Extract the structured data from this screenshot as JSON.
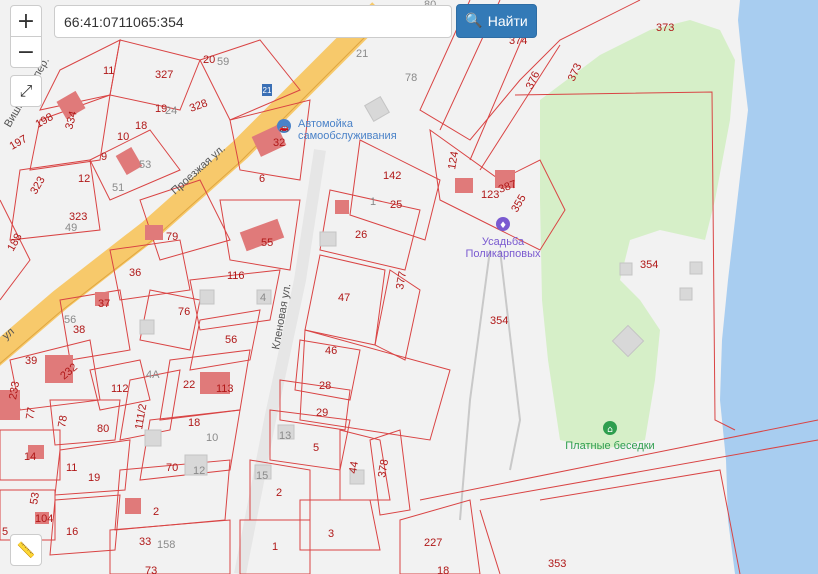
{
  "search": {
    "value": "66:41:0711065:354",
    "button_label": "Найти"
  },
  "controls": {
    "zoom_in": "+",
    "zoom_out": "−",
    "expand": "⤢",
    "ruler": "📏"
  },
  "streets": [
    {
      "id": "prospect",
      "label": "Проезжая ул."
    },
    {
      "id": "klenovaya",
      "label": "Кленовая ул."
    },
    {
      "id": "vishnevy",
      "label": "Вишнёвый пер."
    },
    {
      "id": "ul-left",
      "label": "ул"
    }
  ],
  "pois": [
    {
      "id": "carwash",
      "lines": [
        "Автомойка",
        "самообслуживания"
      ]
    },
    {
      "id": "estate",
      "lines": [
        "Усадьба",
        "Поликарповых"
      ]
    },
    {
      "id": "gazebos",
      "lines": [
        "Платные беседки"
      ]
    }
  ],
  "parcels": [
    "374",
    "373",
    "376",
    "373",
    "80",
    "78",
    "327",
    "328",
    "20",
    "59",
    "11",
    "334",
    "198",
    "19",
    "24",
    "18",
    "10",
    "53",
    "197",
    "9",
    "12",
    "51",
    "32",
    "6",
    "323",
    "323",
    "49",
    "142",
    "124",
    "387",
    "123",
    "355",
    "25",
    "1",
    "26",
    "79",
    "55",
    "188",
    "36",
    "116",
    "4",
    "377",
    "354",
    "354",
    "47",
    "37",
    "56",
    "76",
    "38",
    "56",
    "46",
    "39",
    "232",
    "233",
    "112",
    "4A",
    "22",
    "113",
    "28",
    "77",
    "78",
    "80",
    "111/2",
    "18",
    "10",
    "29",
    "14",
    "11",
    "19",
    "70",
    "12",
    "13",
    "5",
    "44",
    "378",
    "15",
    "2",
    "53",
    "104",
    "2",
    "16",
    "33",
    "158",
    "1",
    "3",
    "227",
    "353",
    "18",
    "73",
    "21",
    "5"
  ],
  "colors": {
    "water": "#a8cdf0",
    "green": "#d6efc8",
    "road": "#f7c96b",
    "parcel_line": "#d94444",
    "building": "#e07a7a",
    "button": "#337ab7"
  }
}
